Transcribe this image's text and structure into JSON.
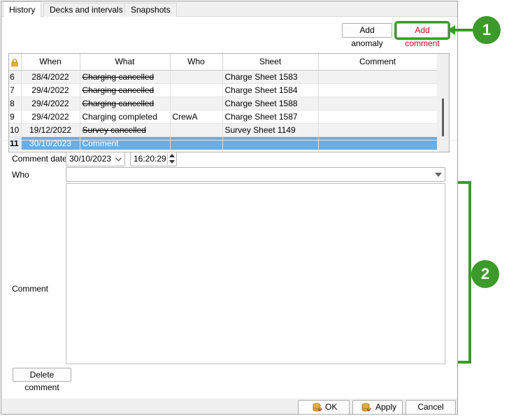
{
  "tabs": [
    "History",
    "Decks and intervals",
    "Snapshots"
  ],
  "toolbar": {
    "add_anomaly": "Add anomaly",
    "add_comment": "Add comment"
  },
  "grid": {
    "columns": [
      "",
      "When",
      "What",
      "Who",
      "Sheet",
      "Comment"
    ],
    "rows": [
      {
        "n": "6",
        "when": "28/4/2022",
        "what": "Charging cancelled",
        "who": "",
        "sheet": "Charge Sheet 1583",
        "comment": "",
        "struck": true
      },
      {
        "n": "7",
        "when": "29/4/2022",
        "what": "Charging cancelled",
        "who": "",
        "sheet": "Charge Sheet 1584",
        "comment": "",
        "struck": true
      },
      {
        "n": "8",
        "when": "29/4/2022",
        "what": "Charging cancelled",
        "who": "",
        "sheet": "Charge Sheet 1588",
        "comment": "",
        "struck": true
      },
      {
        "n": "9",
        "when": "29/4/2022",
        "what": "Charging completed",
        "who": "CrewA",
        "sheet": "Charge Sheet 1587",
        "comment": "",
        "struck": false
      },
      {
        "n": "10",
        "when": "19/12/2022",
        "what": "Survey cancelled",
        "who": "",
        "sheet": "Survey Sheet 1149",
        "comment": "",
        "struck": true
      },
      {
        "n": "11",
        "when": "30/10/2023",
        "what": "Comment",
        "who": "",
        "sheet": "",
        "comment": "",
        "struck": false,
        "selected": true
      }
    ]
  },
  "form": {
    "comment_date_label": "Comment date",
    "date_value": "30/10/2023",
    "time_value": "16:20:29",
    "who_label": "Who",
    "who_value": "",
    "comment_label": "Comment",
    "comment_value": "",
    "delete_button": "Delete comment"
  },
  "footer": {
    "ok": "OK",
    "apply": "Apply",
    "cancel": "Cancel"
  },
  "callouts": [
    "1",
    "2"
  ],
  "colors": {
    "callout_green": "#3c9a2a",
    "selection_blue": "#6aaee6",
    "add_comment_red": "#d0021b"
  }
}
